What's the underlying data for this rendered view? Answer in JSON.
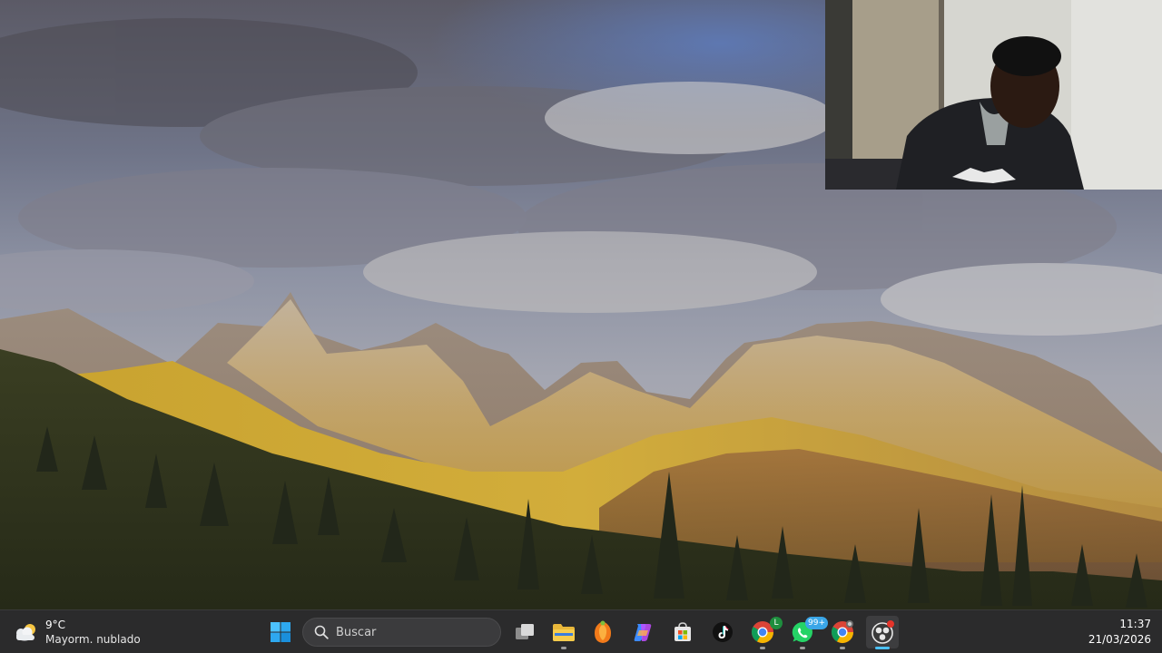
{
  "taskbar": {
    "weather": {
      "temperature": "9°C",
      "condition": "Mayorm. nublado",
      "icon": "partly-cloudy-icon"
    },
    "start_icon": "windows-logo-icon",
    "search": {
      "placeholder": "Buscar",
      "icon": "search-icon"
    },
    "apps": [
      {
        "name": "task-view",
        "icon": "task-view-icon"
      },
      {
        "name": "file-explorer",
        "icon": "folder-icon",
        "running": true
      },
      {
        "name": "fl-studio",
        "icon": "fl-studio-icon"
      },
      {
        "name": "copilot",
        "icon": "copilot-icon"
      },
      {
        "name": "microsoft-store",
        "icon": "store-icon"
      },
      {
        "name": "tiktok",
        "icon": "tiktok-icon"
      },
      {
        "name": "chrome-profile",
        "icon": "chrome-icon",
        "badge": "L",
        "running": true
      },
      {
        "name": "whatsapp",
        "icon": "whatsapp-icon",
        "badge": "99+",
        "running": true
      },
      {
        "name": "chrome",
        "icon": "chrome-icon",
        "running": true
      },
      {
        "name": "obs-studio",
        "icon": "obs-icon",
        "active": true
      }
    ],
    "clock": {
      "time": "11:37",
      "date": "21/03/2026"
    }
  },
  "colors": {
    "taskbar_bg": "#2b2b2c",
    "accent": "#4cc2ff",
    "whatsapp_badge": "#3aa6e8",
    "profile_badge": "#1e8e3e",
    "obs_dot": "#e5342a"
  }
}
